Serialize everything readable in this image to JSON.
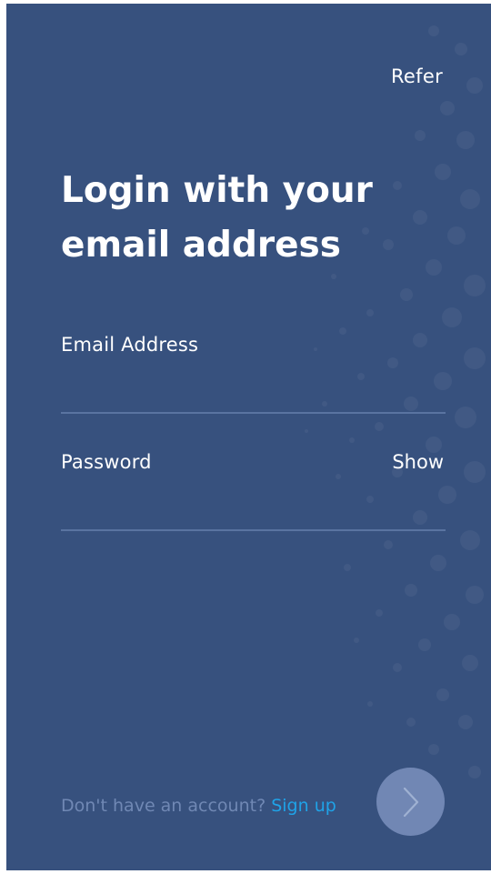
{
  "header": {
    "refer_label": "Refer"
  },
  "login": {
    "title_line1": "Login with your",
    "title_line2": "email address",
    "email_label": "Email Address",
    "email_value": "",
    "password_label": "Password",
    "password_value": "",
    "show_label": "Show"
  },
  "footer": {
    "prompt": "Don't have an account?",
    "signup_label": "Sign up"
  },
  "colors": {
    "background": "#37517e",
    "text": "#ffffff",
    "link": "#1fa3e8",
    "muted": "#7088b4",
    "button": "#7187b4"
  },
  "icons": {
    "next": "chevron-right-icon"
  }
}
